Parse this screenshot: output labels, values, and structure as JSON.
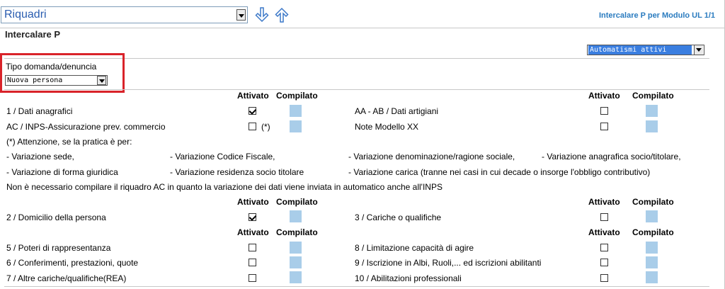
{
  "toolbar": {
    "riquadri_value": "Riquadri",
    "right_label": "Intercalare P per Modulo UL 1/1"
  },
  "section": {
    "title": "Intercalare P",
    "automatismi_value": "Automatismi attivi"
  },
  "tipo": {
    "label": "Tipo domanda/denuncia",
    "value": "Nuova persona"
  },
  "headers": {
    "attivato": "Attivato",
    "compilato": "Compilato"
  },
  "group1": {
    "left": [
      {
        "label": "1 / Dati anagrafici",
        "checked": true
      },
      {
        "label": "AC / INPS-Assicurazione prev. commercio",
        "checked": false,
        "suffix": "(*)"
      }
    ],
    "right": [
      {
        "label": "AA - AB / Dati artigiani",
        "checked": false
      },
      {
        "label": "Note Modello XX",
        "checked": false
      }
    ]
  },
  "notes": {
    "attention": "(*) Attenzione, se la pratica è per:",
    "items_row1": [
      "- Variazione sede,",
      "- Variazione Codice Fiscale,",
      "- Variazione denominazione/ragione sociale,",
      "- Variazione anagrafica socio/titolare,"
    ],
    "items_row2": [
      "- Variazione di forma giuridica",
      "- Variazione residenza socio titolare",
      "- Variazione carica (tranne nei casi in cui decade o insorge l'obbligo contributivo)"
    ],
    "footer": "Non è necessario compilare il riquadro AC in quanto la variazione dei dati viene inviata in automatico anche all'INPS"
  },
  "group2": {
    "left": [
      {
        "label": "2 / Domicilio della persona",
        "checked": true
      }
    ],
    "right": [
      {
        "label": "3 / Cariche o qualifiche",
        "checked": false
      }
    ]
  },
  "group3": {
    "left": [
      {
        "label": "5 / Poteri di rappresentanza",
        "checked": false
      },
      {
        "label": "6 / Conferimenti, prestazioni, quote",
        "checked": false
      },
      {
        "label": "7 / Altre cariche/qualifiche(REA)",
        "checked": false
      }
    ],
    "right": [
      {
        "label": "8 / Limitazione capacità di agire",
        "checked": false
      },
      {
        "label": "9 / Iscrizione in Albi, Ruoli,... ed iscrizioni abilitanti",
        "checked": false
      },
      {
        "label": "10 / Abilitazioni professionali",
        "checked": false
      }
    ]
  }
}
